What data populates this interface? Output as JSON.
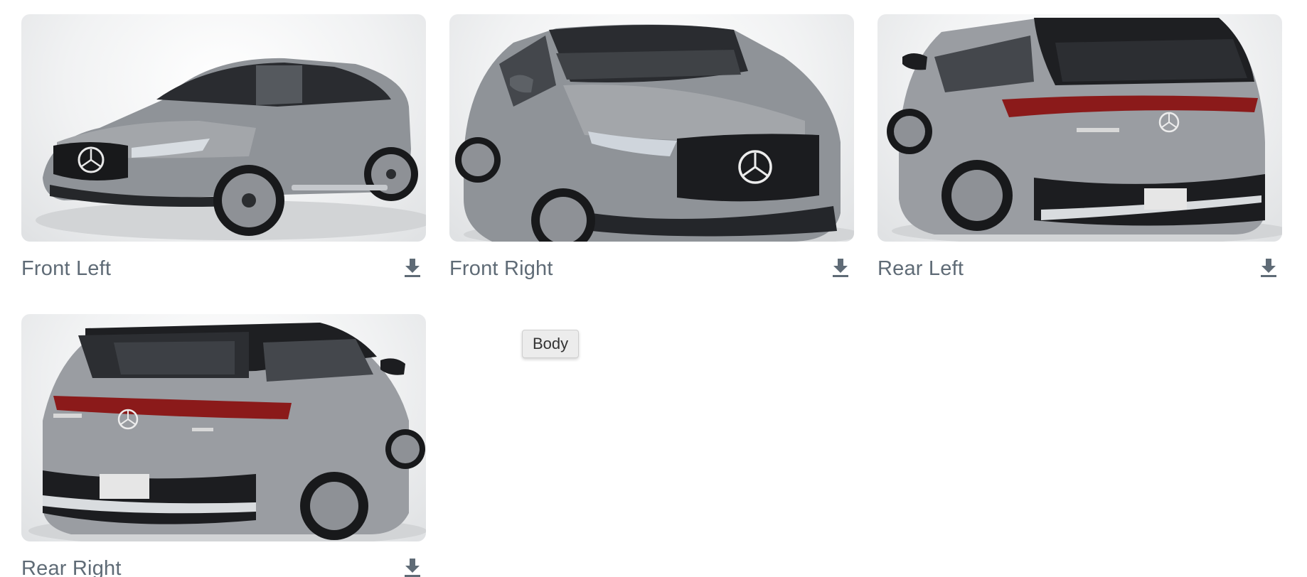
{
  "gallery": {
    "items": [
      {
        "label": "Front Left"
      },
      {
        "label": "Front Right"
      },
      {
        "label": "Rear Left"
      },
      {
        "label": "Rear Right"
      }
    ],
    "download_icon": "download-icon"
  },
  "tooltip": {
    "text": "Body"
  },
  "colors": {
    "label": "#5f6b76",
    "car_body": "#9a9da2",
    "car_dark": "#1c1d20",
    "taillight": "#8b1a1a"
  }
}
